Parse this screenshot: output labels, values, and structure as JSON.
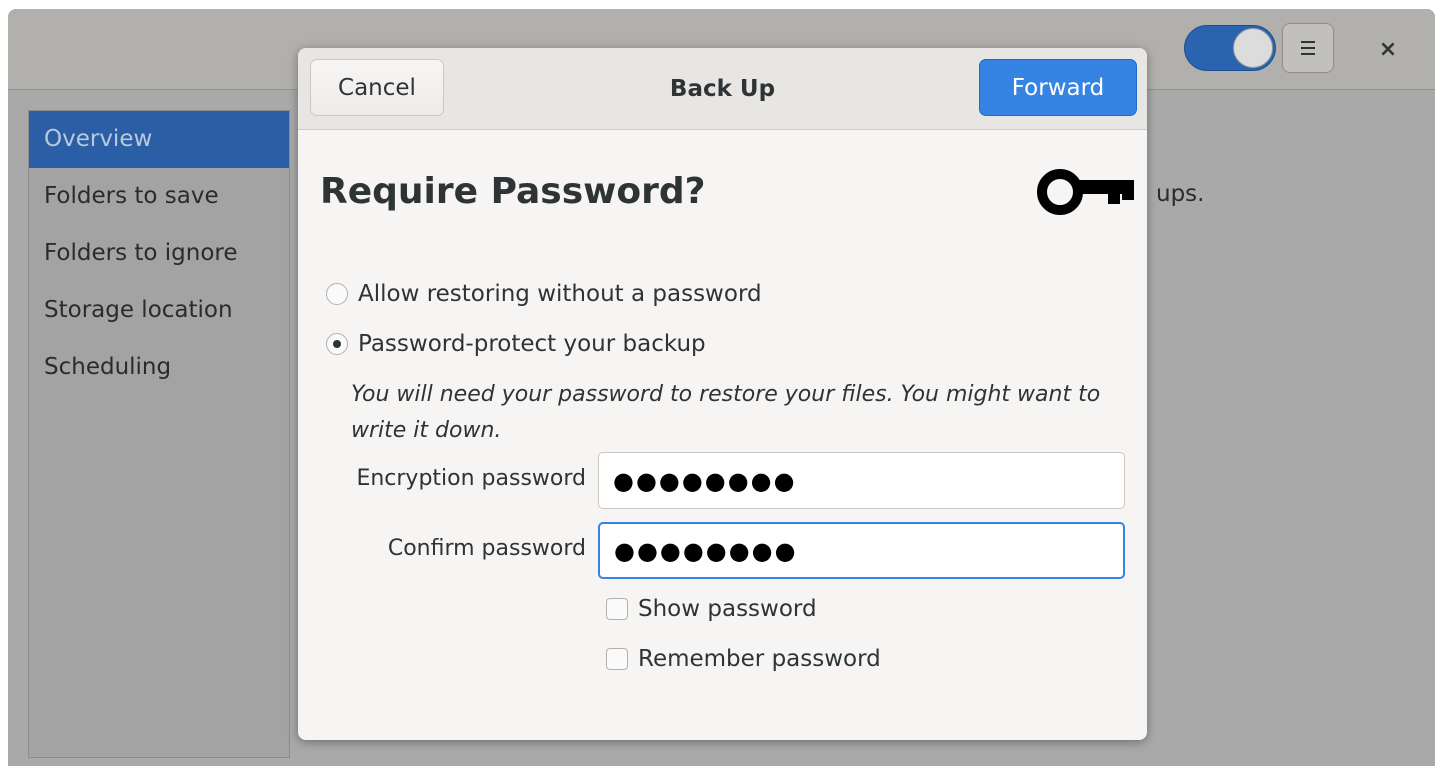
{
  "window": {
    "close_glyph": "×",
    "switch_on": true
  },
  "sidebar": {
    "items": [
      {
        "label": "Overview",
        "selected": true
      },
      {
        "label": "Folders to save"
      },
      {
        "label": "Folders to ignore"
      },
      {
        "label": "Storage location"
      },
      {
        "label": "Scheduling"
      }
    ]
  },
  "background": {
    "partial_text": "ups."
  },
  "dialog": {
    "title": "Back Up",
    "cancel_label": "Cancel",
    "forward_label": "Forward",
    "heading": "Require Password?",
    "icon": "key-icon",
    "options": [
      {
        "label": "Allow restoring without a password",
        "selected": false
      },
      {
        "label": "Password-protect your backup",
        "selected": true
      }
    ],
    "note": "You will need your password to restore your files. You might want to write it down.",
    "fields": [
      {
        "label": "Encryption password",
        "value": "●●●●●●●●"
      },
      {
        "label": "Confirm password",
        "value": "●●●●●●●●"
      }
    ],
    "checkboxes": [
      {
        "label": "Show password",
        "checked": false
      },
      {
        "label": "Remember password",
        "checked": false
      }
    ]
  },
  "colors": {
    "accent": "#3584e4",
    "selected_sidebar": "#2a5fa6"
  }
}
